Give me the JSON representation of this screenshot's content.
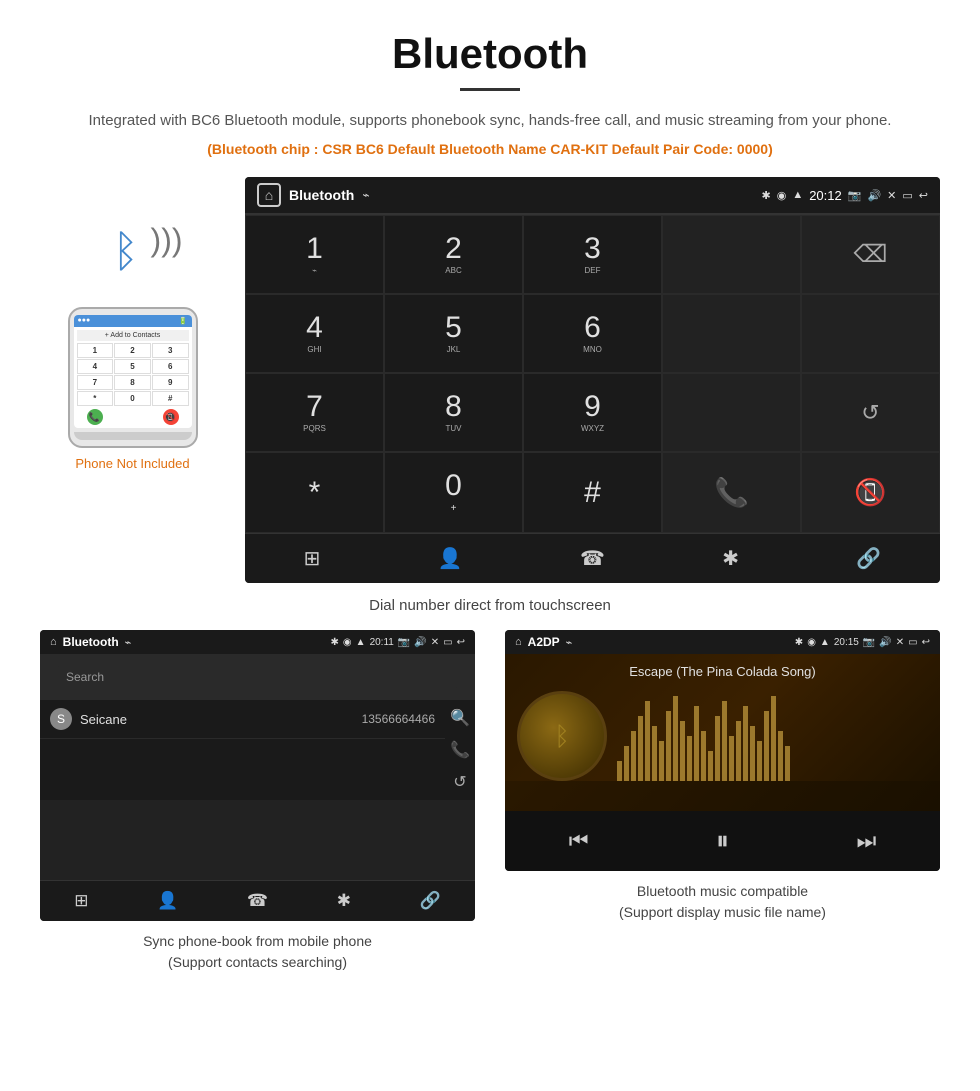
{
  "title": "Bluetooth",
  "divider": "—",
  "description": "Integrated with BC6 Bluetooth module, supports phonebook sync, hands-free call, and music streaming from your phone.",
  "specs": "(Bluetooth chip : CSR BC6    Default Bluetooth Name CAR-KIT    Default Pair Code: 0000)",
  "main_screen": {
    "statusbar_title": "Bluetooth",
    "time": "20:12",
    "usb_icon": "⌁",
    "bt_icon": "✱",
    "location_icon": "◉",
    "signal_icon": "▲",
    "dialpad": [
      {
        "digit": "1",
        "sub": "⌁",
        "type": "digit"
      },
      {
        "digit": "2",
        "sub": "ABC",
        "type": "digit"
      },
      {
        "digit": "3",
        "sub": "DEF",
        "type": "digit"
      },
      {
        "digit": "",
        "sub": "",
        "type": "empty"
      },
      {
        "digit": "⌫",
        "sub": "",
        "type": "delete"
      },
      {
        "digit": "4",
        "sub": "GHI",
        "type": "digit"
      },
      {
        "digit": "5",
        "sub": "JKL",
        "type": "digit"
      },
      {
        "digit": "6",
        "sub": "MNO",
        "type": "digit"
      },
      {
        "digit": "",
        "sub": "",
        "type": "empty"
      },
      {
        "digit": "",
        "sub": "",
        "type": "empty"
      },
      {
        "digit": "7",
        "sub": "PQRS",
        "type": "digit"
      },
      {
        "digit": "8",
        "sub": "TUV",
        "type": "digit"
      },
      {
        "digit": "9",
        "sub": "WXYZ",
        "type": "digit"
      },
      {
        "digit": "",
        "sub": "",
        "type": "empty"
      },
      {
        "digit": "↺",
        "sub": "",
        "type": "reload"
      },
      {
        "digit": "*",
        "sub": "",
        "type": "digit"
      },
      {
        "digit": "0",
        "sub": "+",
        "type": "digit-plus"
      },
      {
        "digit": "#",
        "sub": "",
        "type": "digit"
      },
      {
        "digit": "📞",
        "sub": "",
        "type": "call"
      },
      {
        "digit": "📵",
        "sub": "",
        "type": "end"
      }
    ],
    "bottom_nav": [
      "⊞",
      "👤",
      "☎",
      "✱",
      "🔗"
    ]
  },
  "main_caption": "Dial number direct from touchscreen",
  "phone_not_included": "Phone Not Included",
  "bottom_left": {
    "statusbar_title": "Bluetooth",
    "time": "20:11",
    "search_placeholder": "Search",
    "contact_letter": "S",
    "contact_name": "Seicane",
    "contact_number": "13566664466",
    "side_icons": [
      "🔍",
      "📞",
      "↺"
    ],
    "bottom_nav": [
      "⊞",
      "👤",
      "☎",
      "✱",
      "🔗"
    ],
    "caption_line1": "Sync phone-book from mobile phone",
    "caption_line2": "(Support contacts searching)"
  },
  "bottom_right": {
    "statusbar_title": "A2DP",
    "time": "20:15",
    "song_title": "Escape (The Pina Colada Song)",
    "music_icon": "♪",
    "bt_music_icon": "✱",
    "controls": [
      "⏮",
      "⏭",
      "⏭"
    ],
    "play_pause": "⏸",
    "caption_line1": "Bluetooth music compatible",
    "caption_line2": "(Support display music file name)"
  },
  "viz_bars": [
    20,
    35,
    50,
    65,
    80,
    55,
    40,
    70,
    85,
    60,
    45,
    75,
    50,
    30,
    65,
    80,
    45,
    60,
    75,
    55,
    40,
    70,
    85,
    50,
    35
  ]
}
